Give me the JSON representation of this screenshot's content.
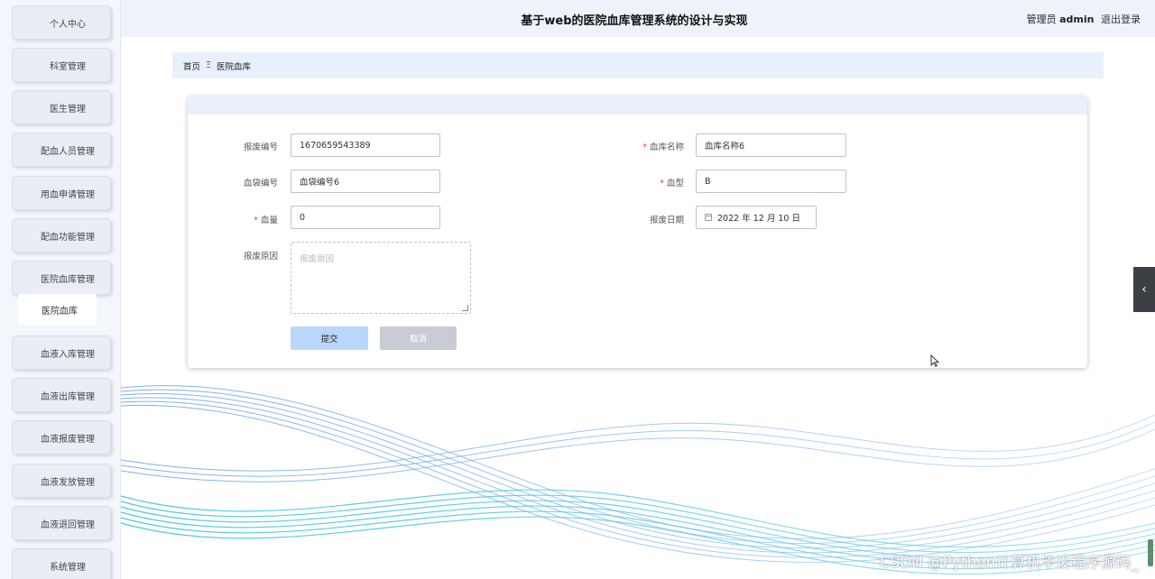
{
  "header": {
    "title": "基于web的医院血库管理系统的设计与实现",
    "user_role": "管理员",
    "user_name": "admin",
    "logout": "退出登录"
  },
  "sidebar": {
    "items": [
      {
        "label": "个人中心"
      },
      {
        "label": "科室管理"
      },
      {
        "label": "医生管理"
      },
      {
        "label": "配血人员管理"
      },
      {
        "label": "用血申请管理"
      },
      {
        "label": "配血功能管理"
      },
      {
        "label": "医院血库管理"
      },
      {
        "label": "血液入库管理"
      },
      {
        "label": "血液出库管理"
      },
      {
        "label": "血液报废管理"
      },
      {
        "label": "血液发放管理"
      },
      {
        "label": "血液退回管理"
      },
      {
        "label": "系统管理"
      }
    ],
    "active_sub": "医院血库"
  },
  "breadcrumb": {
    "home": "首页",
    "separator": "Ξ",
    "current": "医院血库"
  },
  "form": {
    "scrap_no_label": "报废编号",
    "scrap_no_value": "1670659543389",
    "bank_name_label": "血库名称",
    "bank_name_value": "血库名称6",
    "bag_no_label": "血袋编号",
    "bag_no_value": "血袋编号6",
    "blood_type_label": "血型",
    "blood_type_value": "B",
    "amount_label": "血量",
    "amount_value": "0",
    "scrap_date_label": "报废日期",
    "scrap_date_value": "2022 年 12 月 10 日",
    "reason_label": "报废原因",
    "reason_placeholder": "报废原因",
    "required_mark": "*",
    "submit": "提交",
    "cancel": "取消"
  },
  "watermark": "CSDN @Python计算机毕设程序源码_",
  "colors": {
    "header_bg": "#eef3fb",
    "accent_light": "#b9d6fb",
    "required": "#e44444",
    "cancel_bg": "#c9ccd3"
  },
  "icons": {
    "toggle": "chevron-left-icon",
    "date": "calendar-icon"
  }
}
